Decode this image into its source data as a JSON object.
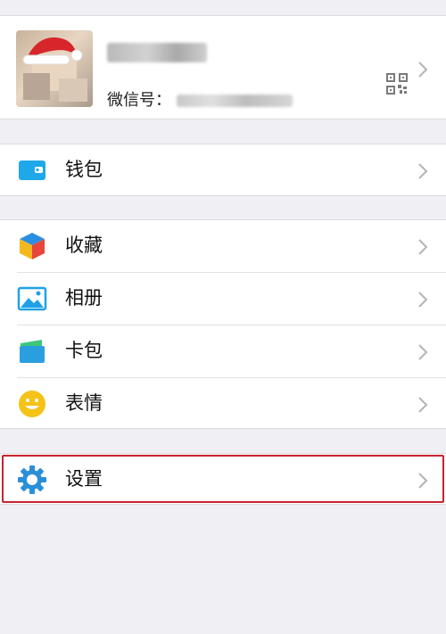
{
  "profile": {
    "wechat_id_label": "微信号：",
    "qr_icon": "qr-code-icon",
    "chevron_icon": "chevron-right-icon"
  },
  "menu": {
    "wallet": {
      "label": "钱包",
      "icon": "wallet-icon",
      "icon_color": "#1ea8ea"
    },
    "favorites": {
      "label": "收藏",
      "icon": "cube-icon"
    },
    "album": {
      "label": "相册",
      "icon": "photo-icon",
      "icon_color": "#1fa1e8"
    },
    "cards": {
      "label": "卡包",
      "icon": "card-holder-icon",
      "icon_color": "#2a9fe0"
    },
    "stickers": {
      "label": "表情",
      "icon": "smiley-icon",
      "icon_color": "#f5c218"
    },
    "settings": {
      "label": "设置",
      "icon": "gear-icon",
      "icon_color": "#2a8fd8"
    }
  },
  "colors": {
    "background": "#efeff4",
    "highlight_border": "#c8242f"
  }
}
